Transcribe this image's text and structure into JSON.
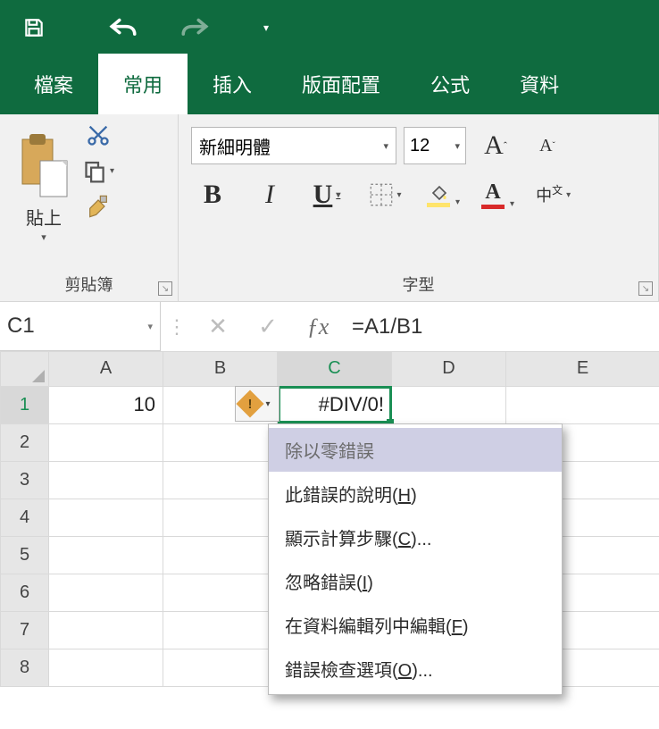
{
  "qat": {
    "save": "save",
    "undo": "undo",
    "redo": "redo",
    "customize": "customize"
  },
  "tabs": {
    "file": "檔案",
    "home": "常用",
    "insert": "插入",
    "layout": "版面配置",
    "formulas": "公式",
    "data": "資料"
  },
  "ribbon": {
    "clipboard": {
      "paste": "貼上",
      "group_label": "剪貼簿"
    },
    "font": {
      "name": "新細明體",
      "size": "12",
      "group_label": "字型",
      "bold": "B",
      "italic": "I",
      "underline": "U",
      "phonetic": "中"
    }
  },
  "formula_bar": {
    "name_box": "C1",
    "formula": "=A1/B1"
  },
  "columns": [
    "A",
    "B",
    "C",
    "D",
    "E"
  ],
  "rows": [
    "1",
    "2",
    "3",
    "4",
    "5",
    "6",
    "7",
    "8"
  ],
  "cells": {
    "A1": "10",
    "C1": "#DIV/0!"
  },
  "menu": {
    "header": "除以零錯誤",
    "help_pre": "此錯誤的說明(",
    "help_key": "H",
    "help_post": ")",
    "calc_pre": "顯示計算步驟(",
    "calc_key": "C",
    "calc_post": ")...",
    "ignore_pre": "忽略錯誤(",
    "ignore_key": "I",
    "ignore_post": ")",
    "editbar_pre": "在資料編輯列中編輯(",
    "editbar_key": "F",
    "editbar_post": ")",
    "options_pre": "錯誤檢查選項(",
    "options_key": "O",
    "options_post": ")..."
  }
}
